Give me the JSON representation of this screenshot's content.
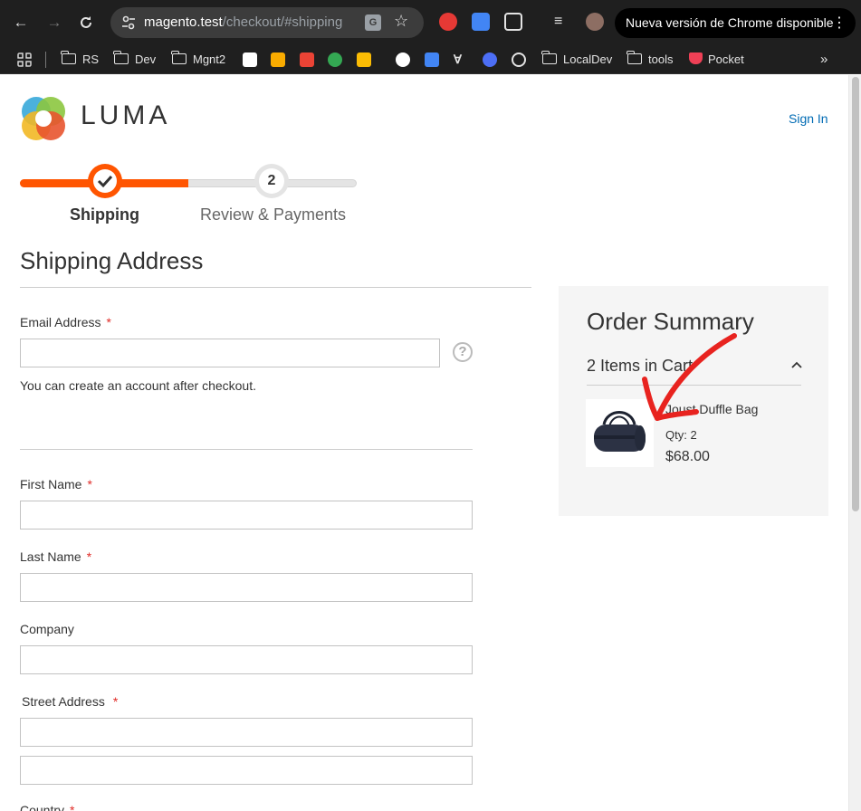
{
  "browser": {
    "url_host": "magento.test",
    "url_path": "/checkout/#shipping",
    "update_button": "Nueva versión de Chrome disponible",
    "bookmarks": [
      "RS",
      "Dev",
      "Mgnt2",
      "LocalDev",
      "tools",
      "Pocket"
    ]
  },
  "header": {
    "logo_text": "LUMA",
    "sign_in": "Sign In"
  },
  "progress": {
    "steps": [
      {
        "label": "Shipping",
        "state": "complete"
      },
      {
        "label": "Review & Payments",
        "number": "2",
        "state": "pending"
      }
    ],
    "accent": "#ff5501"
  },
  "form": {
    "title": "Shipping Address",
    "email_label": "Email Address",
    "email_note": "You can create an account after checkout.",
    "first_name_label": "First Name",
    "last_name_label": "Last Name",
    "company_label": "Company",
    "street_label": "Street Address",
    "country_label": "Country",
    "required_mark": "*",
    "help_glyph": "?"
  },
  "summary": {
    "title": "Order Summary",
    "items_in_cart": "2 Items in Cart",
    "item": {
      "name": "Joust Duffle Bag",
      "qty": "Qty: 2",
      "price": "$68.00"
    }
  }
}
